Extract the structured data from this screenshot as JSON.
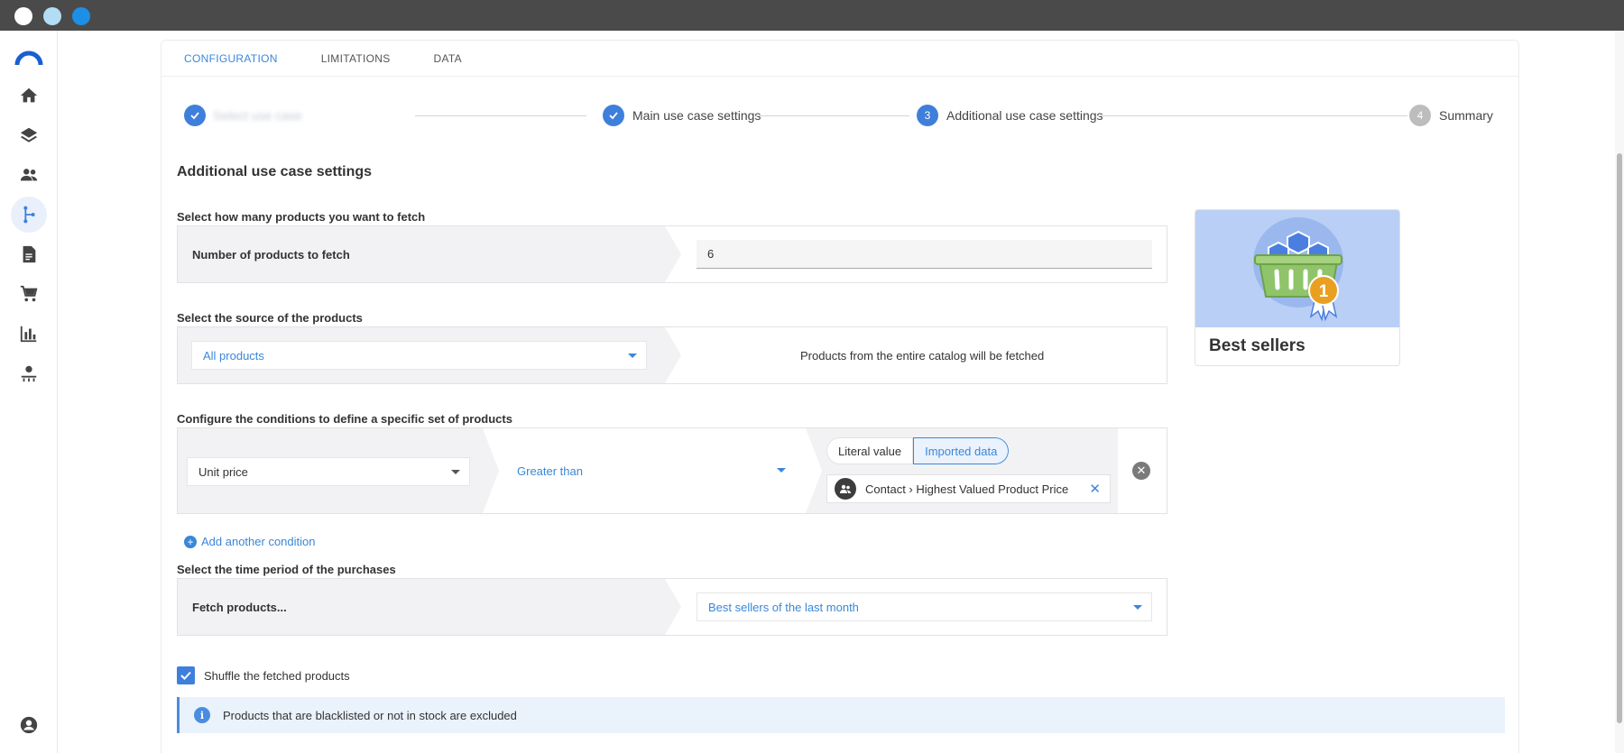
{
  "tabs": [
    {
      "label": "CONFIGURATION"
    },
    {
      "label": "LIMITATIONS"
    },
    {
      "label": "DATA"
    }
  ],
  "stepper": {
    "steps": [
      {
        "number": "1",
        "label": "Select use case",
        "status": "done"
      },
      {
        "number": "2",
        "label": "Main use case settings",
        "status": "done"
      },
      {
        "number": "3",
        "label": "Additional use case settings",
        "status": "current"
      },
      {
        "number": "4",
        "label": "Summary",
        "status": "todo"
      }
    ]
  },
  "main": {
    "title": "Additional use case settings",
    "fetch_count": {
      "group_label": "Select how many products you want to fetch",
      "row_label": "Number of products to fetch",
      "value": "6"
    },
    "source": {
      "group_label": "Select the source of the products",
      "selected": "All products",
      "description": "Products from the entire catalog will be fetched"
    },
    "conditions": {
      "group_label": "Configure the conditions to define a specific set of products",
      "attribute": "Unit price",
      "operator": "Greater than",
      "toggle_literal": "Literal value",
      "toggle_imported": "Imported data",
      "chip_text": "Contact › Highest Valued Product Price",
      "add_label": "Add another condition"
    },
    "time_period": {
      "group_label": "Select the time period of the purchases",
      "row_label": "Fetch products...",
      "selected": "Best sellers of the last month"
    },
    "shuffle": {
      "label": "Shuffle the fetched products",
      "checked": true
    },
    "notice": "Products that are blacklisted or not in stock are excluded"
  },
  "best_sellers_card": {
    "title": "Best sellers",
    "badge": "1"
  },
  "colors": {
    "accent": "#3a87d8",
    "primary": "#3f7fdc",
    "titlebar": "#4a4a4a"
  }
}
